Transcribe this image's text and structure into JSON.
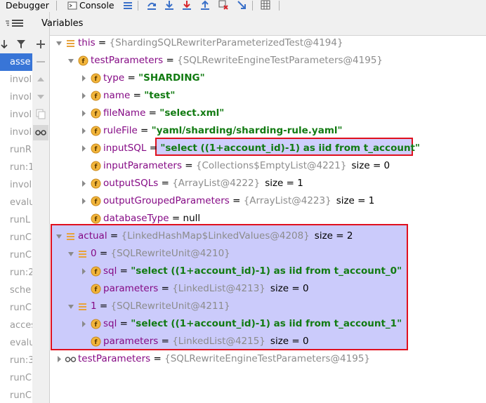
{
  "toolbar": {
    "debugger_tab": "Debugger",
    "console_tab": "Console",
    "icons": [
      "list-icon",
      "step-over-icon",
      "step-into-icon",
      "force-step-into-icon",
      "step-out-icon",
      "drop-frame-icon",
      "run-to-cursor-icon",
      "evaluate-icon"
    ]
  },
  "frames": {
    "items": [
      "asse",
      "invol",
      "invol",
      "invol",
      "invol",
      "runR",
      "run:1",
      "invol",
      "evalu",
      "runL",
      "runC",
      "runC",
      "run:2",
      "sche",
      "runC",
      "acces",
      "evalu",
      "run:3",
      "runC",
      "runC"
    ],
    "selected_index": 0
  },
  "variables": {
    "title": "Variables",
    "rows": [
      {
        "name": "this",
        "eq": " = ",
        "value": "{ShardingSQLRewriterParameterizedTest@4194}",
        "extra": ""
      },
      {
        "name": "testParameters",
        "eq": " = ",
        "value": "{SQLRewriteEngineTestParameters@4195}",
        "extra": ""
      },
      {
        "name": "type",
        "eq": " = ",
        "value": "\"SHARDING\"",
        "extra": ""
      },
      {
        "name": "name",
        "eq": " = ",
        "value": "\"test\"",
        "extra": ""
      },
      {
        "name": "fileName",
        "eq": " = ",
        "value": "\"select.xml\"",
        "extra": ""
      },
      {
        "name": "ruleFile",
        "eq": " = ",
        "value": "\"yaml/sharding/sharding-rule.yaml\"",
        "extra": ""
      },
      {
        "name": "inputSQL",
        "eq": " = ",
        "value": "\"select ((1+account_id)-1) as iid from t_account\"",
        "extra": ""
      },
      {
        "name": "inputParameters",
        "eq": " = ",
        "value": "{Collections$EmptyList@4221}",
        "extra": "size = 0"
      },
      {
        "name": "outputSQLs",
        "eq": " = ",
        "value": "{ArrayList@4222}",
        "extra": "size = 1"
      },
      {
        "name": "outputGroupedParameters",
        "eq": " = ",
        "value": "{ArrayList@4223}",
        "extra": "size = 1"
      },
      {
        "name": "databaseType",
        "eq": " = ",
        "value": "null",
        "extra": ""
      },
      {
        "name": "actual",
        "eq": " = ",
        "value": "{LinkedHashMap$LinkedValues@4208}",
        "extra": "size = 2"
      },
      {
        "name": "0",
        "eq": " = ",
        "value": "{SQLRewriteUnit@4210}",
        "extra": ""
      },
      {
        "name": "sql",
        "eq": " = ",
        "value": "\"select ((1+account_id)-1) as iid from t_account_0\"",
        "extra": ""
      },
      {
        "name": "parameters",
        "eq": " = ",
        "value": "{LinkedList@4213}",
        "extra": "size = 0"
      },
      {
        "name": "1",
        "eq": " = ",
        "value": "{SQLRewriteUnit@4211}",
        "extra": ""
      },
      {
        "name": "sql",
        "eq": " = ",
        "value": "\"select ((1+account_id)-1) as iid from t_account_1\"",
        "extra": ""
      },
      {
        "name": "parameters",
        "eq": " = ",
        "value": "{LinkedList@4215}",
        "extra": "size = 0"
      },
      {
        "name": "testParameters",
        "eq": " = ",
        "value": "{SQLRewriteEngineTestParameters@4195}",
        "extra": ""
      }
    ]
  },
  "colors": {
    "selection": "#3875d7",
    "highlight_border": "#e0101e",
    "string_value": "#127b12",
    "field_icon": "#f2b53b",
    "list_icon": "#e8a33c"
  }
}
